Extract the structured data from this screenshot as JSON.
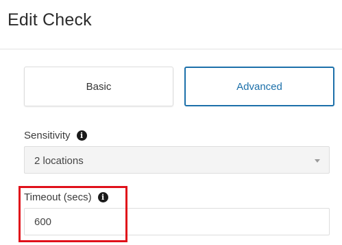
{
  "header": {
    "title": "Edit Check"
  },
  "tabs": {
    "basic_label": "Basic",
    "advanced_label": "Advanced",
    "active": "Advanced",
    "active_color": "#1b6fa9"
  },
  "sensitivity": {
    "label": "Sensitivity",
    "info_icon": "info-icon",
    "selected_value": "2 locations"
  },
  "timeout": {
    "label": "Timeout (secs)",
    "info_icon": "info-icon",
    "value": "600"
  },
  "annotation": {
    "highlight_color": "#e0101a",
    "highlight_target": "timeout-field"
  }
}
